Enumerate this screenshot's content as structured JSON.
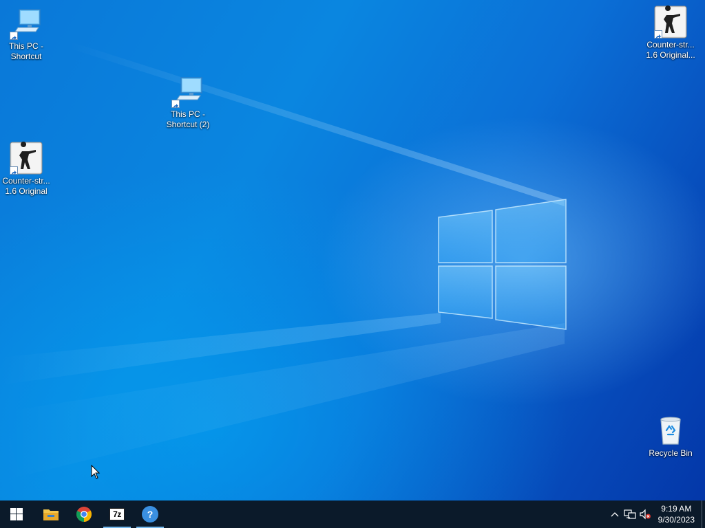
{
  "desktop": {
    "icons": [
      {
        "label": "This PC -\nShortcut",
        "icon": "computer-icon"
      },
      {
        "label": "This PC -\nShortcut (2)",
        "icon": "computer-icon"
      },
      {
        "label": "Counter-str...\n1.6 Original",
        "icon": "counter-strike-icon"
      },
      {
        "label": "Counter-str...\n1.6 Original...",
        "icon": "counter-strike-icon"
      },
      {
        "label": "Recycle Bin",
        "icon": "recycle-bin-icon"
      }
    ]
  },
  "taskbar": {
    "start_icon": "windows-start-icon",
    "apps": [
      {
        "name": "File Explorer",
        "icon": "folder-icon",
        "running": false
      },
      {
        "name": "Google Chrome",
        "icon": "chrome-icon",
        "running": false
      },
      {
        "name": "7-Zip",
        "icon": "7zip-icon",
        "running": true,
        "text": "7z"
      },
      {
        "name": "Get Help",
        "icon": "help-icon",
        "running": true,
        "text": "?"
      }
    ],
    "tray": {
      "icons": [
        "chevron-up-icon",
        "network-icon",
        "volume-muted-icon"
      ],
      "time": "9:19 AM",
      "date": "9/30/2023"
    }
  },
  "colors": {
    "taskbar_bg": "#0b1a2a",
    "desktop_accent": "#0a78d8",
    "running_indicator": "#76b9ed"
  }
}
